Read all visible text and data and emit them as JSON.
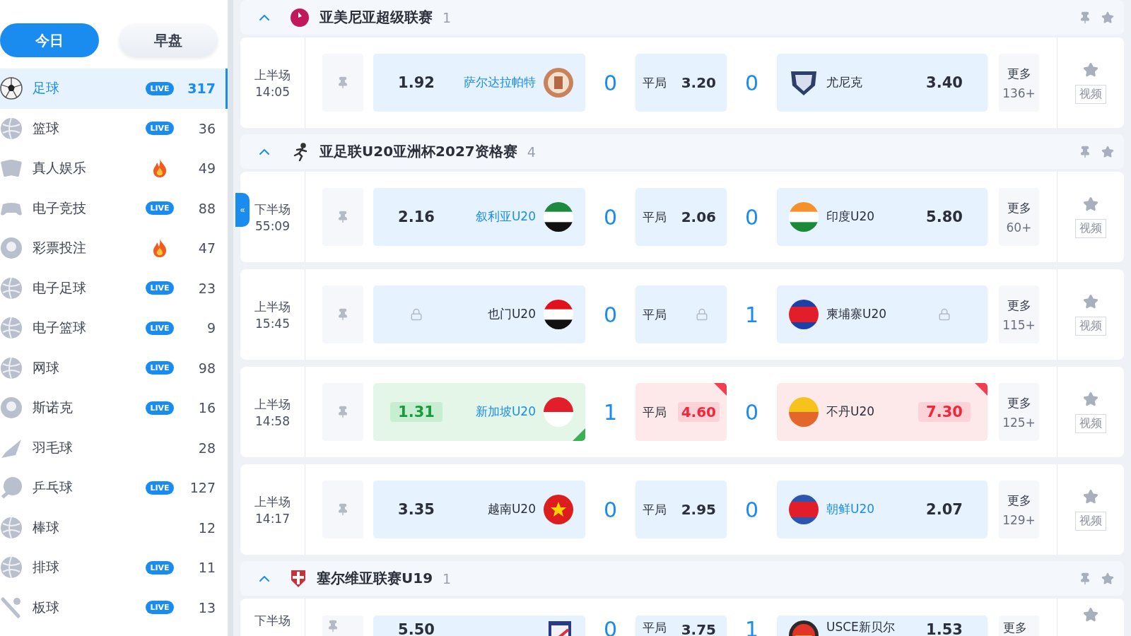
{
  "sidebar": {
    "tabs": [
      {
        "label": "今日",
        "selected": true
      },
      {
        "label": "早盘",
        "selected": false
      }
    ],
    "sports": [
      {
        "name": "足球",
        "marker": {
          "kind": "live",
          "label": "LIVE"
        },
        "count": "317",
        "selected": true
      },
      {
        "name": "篮球",
        "marker": {
          "kind": "live",
          "label": "LIVE"
        },
        "count": "36",
        "selected": false
      },
      {
        "name": "真人娱乐",
        "marker": {
          "kind": "hot"
        },
        "count": "49",
        "selected": false
      },
      {
        "name": "电子竞技",
        "marker": {
          "kind": "live",
          "label": "LIVE"
        },
        "count": "88",
        "selected": false
      },
      {
        "name": "彩票投注",
        "marker": {
          "kind": "hot"
        },
        "count": "47",
        "selected": false
      },
      {
        "name": "电子足球",
        "marker": {
          "kind": "live",
          "label": "LIVE"
        },
        "count": "23",
        "selected": false
      },
      {
        "name": "电子篮球",
        "marker": {
          "kind": "live",
          "label": "LIVE"
        },
        "count": "9",
        "selected": false
      },
      {
        "name": "网球",
        "marker": {
          "kind": "live",
          "label": "LIVE"
        },
        "count": "98",
        "selected": false
      },
      {
        "name": "斯诺克",
        "marker": {
          "kind": "live",
          "label": "LIVE"
        },
        "count": "16",
        "selected": false
      },
      {
        "name": "羽毛球",
        "count": "28",
        "selected": false
      },
      {
        "name": "乒乓球",
        "marker": {
          "kind": "live",
          "label": "LIVE"
        },
        "count": "127",
        "selected": false
      },
      {
        "name": "棒球",
        "count": "12",
        "selected": false
      },
      {
        "name": "排球",
        "marker": {
          "kind": "live",
          "label": "LIVE"
        },
        "count": "11",
        "selected": false
      },
      {
        "name": "板球",
        "marker": {
          "kind": "live",
          "label": "LIVE"
        },
        "count": "13",
        "selected": false
      }
    ]
  },
  "collapse_handle": "«",
  "leagues": [
    {
      "name": "亚美尼亚超级联赛",
      "count": "1",
      "expanded": true,
      "matches": [
        {
          "period": "上半场",
          "clock": "14:05",
          "home": {
            "name": "萨尔达拉帕特",
            "odds": "1.92",
            "favored": true,
            "locked": false,
            "rising": false,
            "falling": false
          },
          "home_score": "0",
          "draw": {
            "label": "平局",
            "odds": "3.20",
            "locked": false,
            "rising": false,
            "falling": false
          },
          "away_score": "0",
          "away": {
            "name": "尤尼克",
            "odds": "3.40",
            "favored": false,
            "locked": false,
            "rising": false,
            "falling": false
          },
          "more": {
            "label": "更多",
            "count": "136+"
          },
          "video": "视频"
        }
      ]
    },
    {
      "name": "亚足联U20亚洲杯2027资格赛",
      "count": "4",
      "expanded": true,
      "matches": [
        {
          "period": "下半场",
          "clock": "55:09",
          "home": {
            "name": "叙利亚U20",
            "odds": "2.16",
            "favored": true,
            "locked": false,
            "rising": false,
            "falling": false
          },
          "home_score": "0",
          "draw": {
            "label": "平局",
            "odds": "2.06",
            "locked": false,
            "rising": false,
            "falling": false
          },
          "away_score": "0",
          "away": {
            "name": "印度U20",
            "odds": "5.80",
            "favored": false,
            "locked": false,
            "rising": false,
            "falling": false
          },
          "more": {
            "label": "更多",
            "count": "60+"
          },
          "video": "视频"
        },
        {
          "period": "上半场",
          "clock": "15:45",
          "home": {
            "name": "也门U20",
            "favored": false,
            "locked": true,
            "rising": false,
            "falling": false
          },
          "home_score": "0",
          "draw": {
            "label": "平局",
            "locked": true,
            "rising": false,
            "falling": false
          },
          "away_score": "1",
          "away": {
            "name": "柬埔寨U20",
            "favored": false,
            "locked": true,
            "rising": false,
            "falling": false
          },
          "more": {
            "label": "更多",
            "count": "115+"
          },
          "video": "视频"
        },
        {
          "period": "上半场",
          "clock": "14:58",
          "home": {
            "name": "新加坡U20",
            "odds": "1.31",
            "favored": true,
            "locked": false,
            "rising": false,
            "falling": true
          },
          "home_score": "1",
          "draw": {
            "label": "平局",
            "odds": "4.60",
            "locked": false,
            "rising": true,
            "falling": false
          },
          "away_score": "0",
          "away": {
            "name": "不丹U20",
            "odds": "7.30",
            "favored": false,
            "locked": false,
            "rising": true,
            "falling": false
          },
          "more": {
            "label": "更多",
            "count": "125+"
          },
          "video": "视频"
        },
        {
          "period": "上半场",
          "clock": "14:17",
          "home": {
            "name": "越南U20",
            "odds": "3.35",
            "favored": false,
            "locked": false,
            "rising": false,
            "falling": false
          },
          "home_score": "0",
          "draw": {
            "label": "平局",
            "odds": "2.95",
            "locked": false,
            "rising": false,
            "falling": false
          },
          "away_score": "0",
          "away": {
            "name": "朝鲜U20",
            "odds": "2.07",
            "favored": true,
            "locked": false,
            "rising": false,
            "falling": false
          },
          "more": {
            "label": "更多",
            "count": "129+"
          },
          "video": "视频"
        }
      ]
    },
    {
      "name": "塞尔维亚联赛U19",
      "count": "1",
      "expanded": true,
      "matches": [
        {
          "period": "下半场",
          "home": {
            "odds": "5.50",
            "locked": false,
            "rising": false,
            "falling": false
          },
          "home_score": "0",
          "draw": {
            "label": "平局",
            "odds": "3.75",
            "locked": false,
            "rising": false,
            "falling": false
          },
          "away_score": "1",
          "away": {
            "name": "USCE新贝尔",
            "odds": "1.53",
            "favored": false,
            "locked": false,
            "rising": false,
            "falling": false
          },
          "more": {
            "label": "更多"
          }
        }
      ]
    }
  ]
}
